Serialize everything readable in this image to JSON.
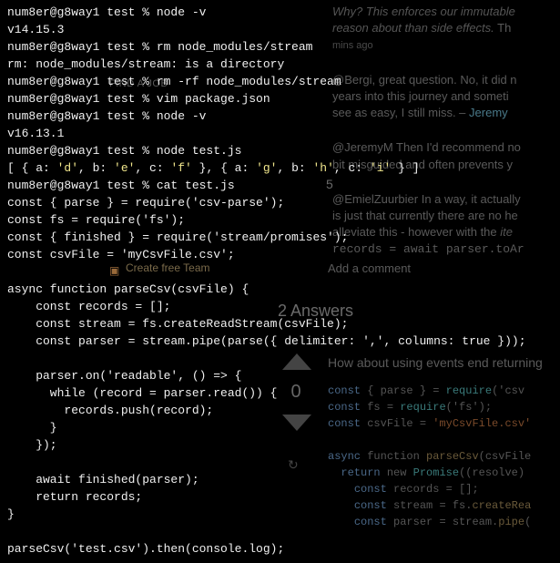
{
  "terminal": {
    "lines": [
      {
        "prompt": "num8er@g8way1 test % ",
        "cmd": "node -v"
      },
      {
        "out": "v14.15.3"
      },
      {
        "prompt": "num8er@g8way1 test % ",
        "cmd": "rm node_modules/stream"
      },
      {
        "out": "rm: node_modules/stream: is a directory"
      },
      {
        "prompt": "num8er@g8way1 test % ",
        "cmd": "rm -rf node_modules/stream"
      },
      {
        "prompt": "num8er@g8way1 test % ",
        "cmd": "vim package.json"
      },
      {
        "prompt": "num8er@g8way1 test % ",
        "cmd": "node -v"
      },
      {
        "out": "v16.13.1"
      },
      {
        "prompt": "num8er@g8way1 test % ",
        "cmd": "node test.js"
      },
      {
        "special_output": true
      },
      {
        "prompt": "num8er@g8way1 test % ",
        "cmd": "cat test.js"
      },
      {
        "out": "const { parse } = require('csv-parse');"
      },
      {
        "out": "const fs = require('fs');"
      },
      {
        "out": "const { finished } = require('stream/promises');"
      },
      {
        "out": "const csvFile = 'myCsvFile.csv';"
      },
      {
        "out": ""
      },
      {
        "out": "async function parseCsv(csvFile) {"
      },
      {
        "out": "    const records = [];"
      },
      {
        "out": "    const stream = fs.createReadStream(csvFile);"
      },
      {
        "out": "    const parser = stream.pipe(parse({ delimiter: ',', columns: true }));"
      },
      {
        "out": ""
      },
      {
        "out": "    parser.on('readable', () => {"
      },
      {
        "out": "      while (record = parser.read()) {"
      },
      {
        "out": "        records.push(record);"
      },
      {
        "out": "      }"
      },
      {
        "out": "    });"
      },
      {
        "out": ""
      },
      {
        "out": "    await finished(parser);"
      },
      {
        "out": "    return records;"
      },
      {
        "out": "}"
      },
      {
        "out": ""
      },
      {
        "out": "parseCsv('test.csv').then(console.log);"
      }
    ],
    "array_output": {
      "prefix": "[ { a: ",
      "vals": [
        "'d'",
        ", b: ",
        "'e'",
        ", c: ",
        "'f'",
        " }, { a: ",
        "'g'",
        ", b: ",
        "'h'",
        ", c: ",
        "'i'",
        " } ]"
      ]
    }
  },
  "background": {
    "comment1_italic": "Why? This enforces our immutable",
    "comment1_line2": "reason about than side effects.",
    "mins_ago": "mins ago",
    "comment2": "@Bergi, great question. No, it did n",
    "comment2_line2": "years into this journey and someti",
    "comment2_line3": "see as easy, I still miss. – ",
    "username2": "Jeremy",
    "comment3": "@JeremyM Then I'd recommend no",
    "comment3_line2": "bit misguided and often prevents y",
    "comment4": "@EmielZuurbier In a way, it actually",
    "comment4_line2": "is just that currently there are no he",
    "comment4_line3": "alleviate this - however with the ",
    "comment4_ite": "ite",
    "comment4_line4": "records = await parser.toAr",
    "find_job": "FIND A JOB",
    "create_team": "Create free Team",
    "add_comment": "Add a comment",
    "answers_heading": "2 Answers",
    "vote_count": "0",
    "badge_5": "5",
    "answer_text": "How about using events end returning",
    "code": {
      "l1_const": "const",
      "l1_rest": " { parse } = ",
      "l1_req": "require",
      "l1_arg": "('csv",
      "l2_const": "const",
      "l2_rest": " fs = ",
      "l2_req": "require",
      "l2_arg": "('fs');",
      "l3_const": "const",
      "l3_rest": " csvFile = ",
      "l3_str": "'myCsvFile.csv'",
      "l4_async": "async",
      "l4_func": " function ",
      "l4_name": "parseCsv",
      "l4_arg": "(csvFile",
      "l5_ret": "return",
      "l5_new": " new ",
      "l5_prom": "Promise",
      "l5_res": "((resolve)",
      "l6_const": "const",
      "l6_rest": " records = [];",
      "l7_const": "const",
      "l7_rest": " stream = fs.",
      "l7_fn": "createRea",
      "l8_const": "const",
      "l8_rest": " parser = stream.",
      "l8_fn": "pipe"
    }
  }
}
